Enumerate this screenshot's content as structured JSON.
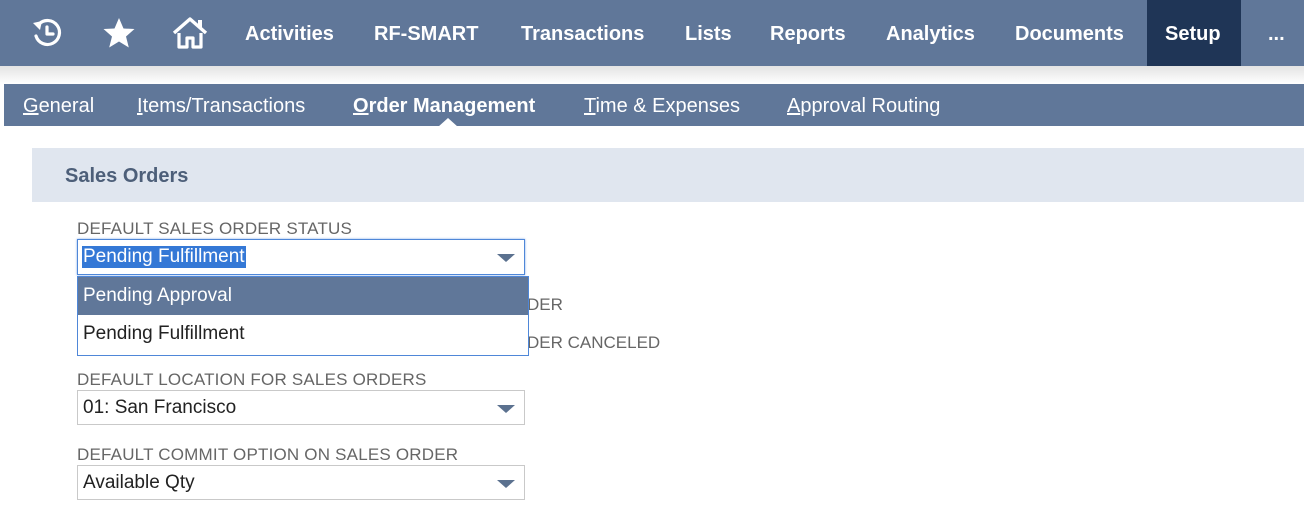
{
  "top_nav": {
    "icons": [
      {
        "name": "recent-history-icon",
        "glyph": "⏱"
      },
      {
        "name": "star-icon",
        "glyph": "★"
      },
      {
        "name": "home-icon",
        "glyph": "⌂"
      }
    ],
    "items": [
      "Activities",
      "RF-SMART",
      "Transactions",
      "Lists",
      "Reports",
      "Analytics",
      "Documents",
      "Setup",
      "..."
    ],
    "active_item": "Setup"
  },
  "sub_nav": {
    "items": [
      {
        "underlined": "G",
        "rest": "eneral"
      },
      {
        "underlined": "I",
        "rest": "tems/Transactions"
      },
      {
        "underlined": "O",
        "rest": "rder Management"
      },
      {
        "underlined": "T",
        "rest": "ime & Expenses"
      },
      {
        "underlined": "A",
        "rest": "pproval Routing"
      }
    ],
    "active_item": "Order Management"
  },
  "section": {
    "title": "Sales Orders"
  },
  "fields": {
    "default_status": {
      "label": "DEFAULT SALES ORDER STATUS",
      "value": "Pending Fulfillment",
      "options": [
        "Pending Approval",
        "Pending Fulfillment"
      ],
      "hovered_option": "Pending Approval"
    },
    "hidden_label_1_tail": "DER",
    "hidden_label_2_tail": "DER CANCELED",
    "default_location": {
      "label": "DEFAULT LOCATION FOR SALES ORDERS",
      "value": "01: San Francisco"
    },
    "default_commit": {
      "label": "DEFAULT COMMIT OPTION ON SALES ORDER",
      "value": "Available Qty"
    }
  },
  "colors": {
    "nav_bg": "#607799",
    "nav_active_bg": "#1f3556",
    "section_bg": "#e0e6ef",
    "section_title": "#4d5f79",
    "selection_highlight": "#3478d6"
  }
}
